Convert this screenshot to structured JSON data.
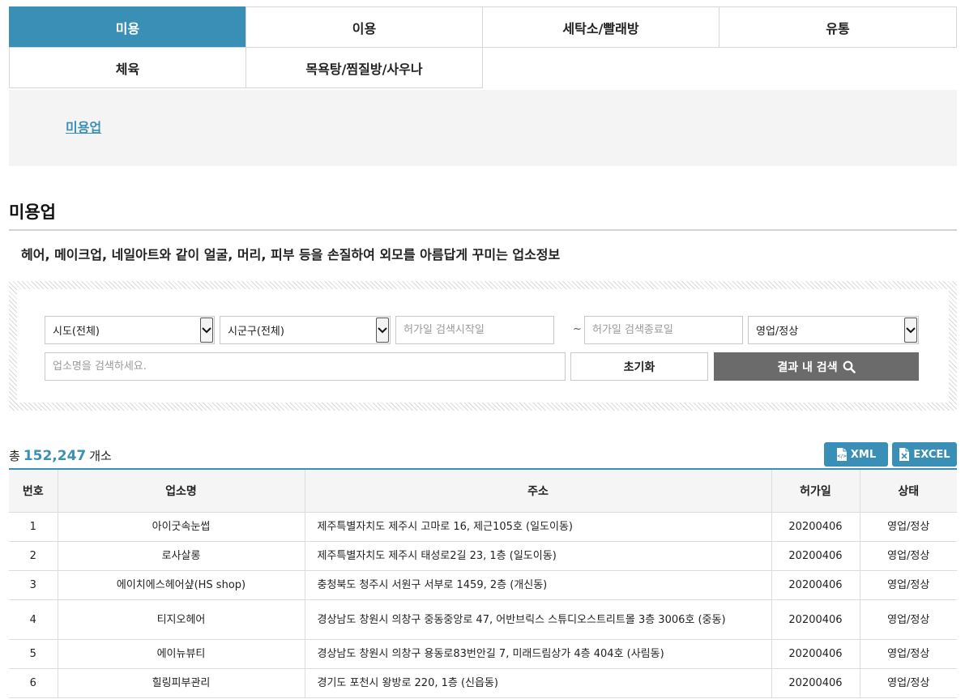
{
  "tabs": [
    {
      "label": "미용",
      "active": true
    },
    {
      "label": "이용",
      "active": false
    },
    {
      "label": "세탁소/빨래방",
      "active": false
    },
    {
      "label": "유통",
      "active": false
    },
    {
      "label": "체육",
      "active": false
    },
    {
      "label": "목욕탕/찜질방/사우나",
      "active": false
    }
  ],
  "subnav": {
    "link": "미용업"
  },
  "page": {
    "title": "미용업",
    "description": "헤어, 메이크업, 네일아트와 같이 얼굴, 머리, 피부 등을 손질하여 외모를 아름답게 꾸미는 업소정보"
  },
  "search": {
    "sido": "시도(전체)",
    "sigungu": "시군구(전체)",
    "start_date_placeholder": "허가일 검색시작일",
    "range_sep": "~",
    "end_date_placeholder": "허가일 검색종료일",
    "status": "영업/정상",
    "name_placeholder": "업소명을 검색하세요.",
    "reset_label": "초기화",
    "search_label": "결과 내 검색"
  },
  "summary": {
    "prefix": "총",
    "count": "152,247",
    "suffix": "개소"
  },
  "export": {
    "xml_label": "XML",
    "excel_label": "EXCEL"
  },
  "table": {
    "headers": [
      "번호",
      "업소명",
      "주소",
      "허가일",
      "상태"
    ],
    "rows": [
      [
        "1",
        "아이굿속눈썹",
        "제주특별자치도 제주시 고마로 16, 제근105호 (일도이동)",
        "20200406",
        "영업/정상"
      ],
      [
        "2",
        "로사살롱",
        "제주특별자치도 제주시 태성로2길 23, 1층 (일도이동)",
        "20200406",
        "영업/정상"
      ],
      [
        "3",
        "에이치에스헤어샾(HS shop)",
        "충청북도 청주시 서원구 서부로 1459, 2층 (개신동)",
        "20200406",
        "영업/정상"
      ],
      [
        "4",
        "티지오헤어",
        "경상남도 창원시 의창구 중동중앙로 47, 어반브릭스 스튜디오스트리트몰 3층 3006호 (중동)",
        "20200406",
        "영업/정상"
      ],
      [
        "5",
        "에이뉴뷰티",
        "경상남도 창원시 의창구 용동로83번안길 7, 미래드림상가 4층 404호 (사림동)",
        "20200406",
        "영업/정상"
      ],
      [
        "6",
        "힐링피부관리",
        "경기도 포천시 왕방로 220, 1층 (신읍동)",
        "20200406",
        "영업/정상"
      ]
    ]
  },
  "colors": {
    "accent": "#3a8fb7",
    "search_button": "#6b6b6b"
  }
}
